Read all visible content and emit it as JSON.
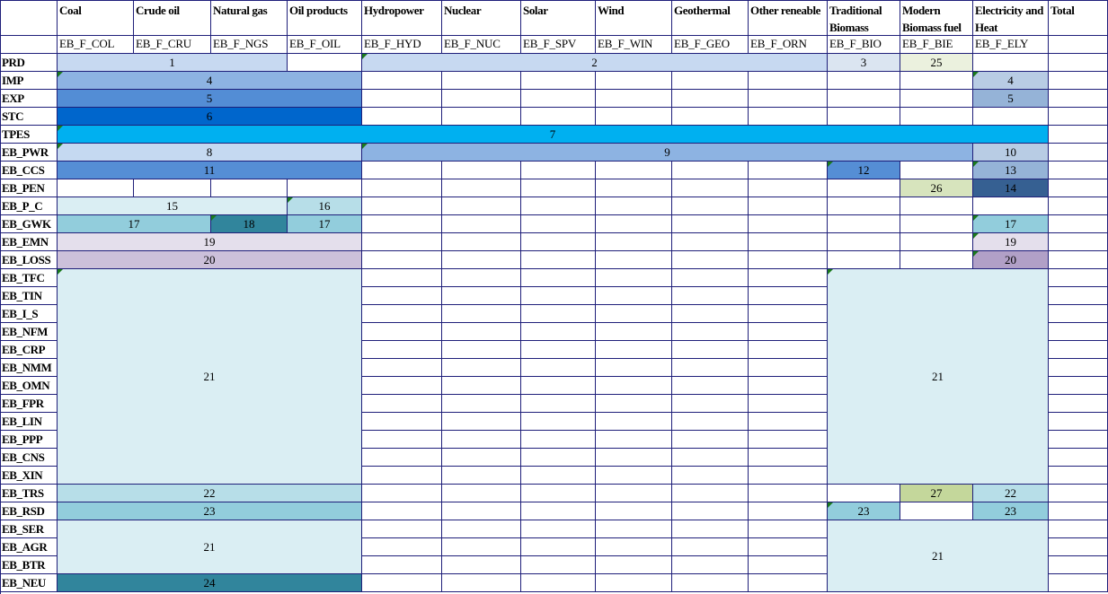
{
  "columns": {
    "headers": [
      "Coal",
      "Crude oil",
      "Natural gas",
      "Oil products",
      "Hydropower",
      "Nuclear",
      "Solar",
      "Wind",
      "Geothermal",
      "Other reneable",
      "Traditional Biomass",
      "Modern Biomass fuel",
      "Electricity and Heat",
      "Total"
    ],
    "codes": [
      "EB_F_COL",
      "EB_F_CRU",
      "EB_F_NGS",
      "EB_F_OIL",
      "EB_F_HYD",
      "EB_F_NUC",
      "EB_F_SPV",
      "EB_F_WIN",
      "EB_F_GEO",
      "EB_F_ORN",
      "EB_F_BIO",
      "EB_F_BIE",
      "EB_F_ELY",
      ""
    ]
  },
  "rows": [
    "PRD",
    "IMP",
    "EXP",
    "STC",
    "TPES",
    "EB_PWR",
    "EB_CCS",
    "EB_PEN",
    "EB_P_C",
    "EB_GWK",
    "EB_EMN",
    "EB_LOSS",
    "EB_TFC",
    "EB_TIN",
    "EB_I_S",
    "EB_NFM",
    "EB_CRP",
    "EB_NMM",
    "EB_OMN",
    "EB_FPR",
    "EB_LIN",
    "EB_PPP",
    "EB_CNS",
    "EB_XIN",
    "EB_TRS",
    "EB_RSD",
    "EB_SER",
    "EB_AGR",
    "EB_BTR",
    "EB_NEU"
  ],
  "blocks": [
    {
      "label": "1",
      "color": "#c7d9f1"
    },
    {
      "label": "2",
      "color": "#c7d9f1"
    },
    {
      "label": "3",
      "color": "#dbe5f1"
    },
    {
      "label": "25",
      "color": "#ebf1de"
    },
    {
      "label": "4",
      "color": "#8db3e2"
    },
    {
      "label": "4",
      "color": "#b8cce4"
    },
    {
      "label": "5",
      "color": "#538dd5"
    },
    {
      "label": "5",
      "color": "#95b3d7"
    },
    {
      "label": "6",
      "color": "#0066cc"
    },
    {
      "label": "7",
      "color": "#00b0f0"
    },
    {
      "label": "8",
      "color": "#c5d9f1"
    },
    {
      "label": "9",
      "color": "#8db3e2"
    },
    {
      "label": "10",
      "color": "#b8cce4"
    },
    {
      "label": "11",
      "color": "#558ed5"
    },
    {
      "label": "12",
      "color": "#558ed5"
    },
    {
      "label": "13",
      "color": "#95b3d7"
    },
    {
      "label": "26",
      "color": "#d7e4bd"
    },
    {
      "label": "14",
      "color": "#366092"
    },
    {
      "label": "15",
      "color": "#daeef3"
    },
    {
      "label": "16",
      "color": "#b7dee8"
    },
    {
      "label": "17",
      "color": "#92cddc"
    },
    {
      "label": "18",
      "color": "#31859c"
    },
    {
      "label": "17",
      "color": "#92cddc"
    },
    {
      "label": "17",
      "color": "#92cddc"
    },
    {
      "label": "19",
      "color": "#e4dfec"
    },
    {
      "label": "19",
      "color": "#e4dfec"
    },
    {
      "label": "20",
      "color": "#ccc0da"
    },
    {
      "label": "20",
      "color": "#b1a0c7"
    },
    {
      "label": "21",
      "color": "#daeef3"
    },
    {
      "label": "21",
      "color": "#daeef3"
    },
    {
      "label": "22",
      "color": "#b7dee8"
    },
    {
      "label": "27",
      "color": "#c4d79b"
    },
    {
      "label": "22",
      "color": "#b7dee8"
    },
    {
      "label": "23",
      "color": "#92cddc"
    },
    {
      "label": "23",
      "color": "#92cddc"
    },
    {
      "label": "23",
      "color": "#92cddc"
    },
    {
      "label": "21",
      "color": "#daeef3"
    },
    {
      "label": "21",
      "color": "#daeef3"
    },
    {
      "label": "24",
      "color": "#31859c"
    }
  ]
}
